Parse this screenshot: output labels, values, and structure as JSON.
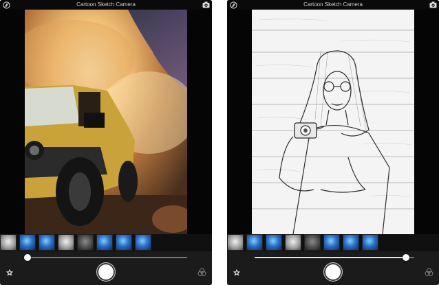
{
  "screens": [
    {
      "title": "Cartoon Sketch Camera",
      "filters": [
        "gray",
        "blue",
        "blue",
        "gray",
        "dark",
        "blue",
        "blue",
        "blue"
      ],
      "slider_value": 0.0
    },
    {
      "title": "Cartoon Sketch Camera",
      "filters": [
        "gray",
        "blue",
        "blue",
        "gray",
        "dark",
        "blue",
        "blue",
        "blue"
      ],
      "slider_value": 0.95
    }
  ],
  "icons": {
    "flash": "flash-off-icon",
    "camera_switch": "camera-switch-icon",
    "favorites": "star-icon",
    "effects": "effects-icon",
    "shutter": "shutter-button"
  },
  "colors": {
    "bar_background": "#1b1b1b",
    "thumb_blue": "#2d6fc7",
    "title_text": "#cfcfcf"
  }
}
